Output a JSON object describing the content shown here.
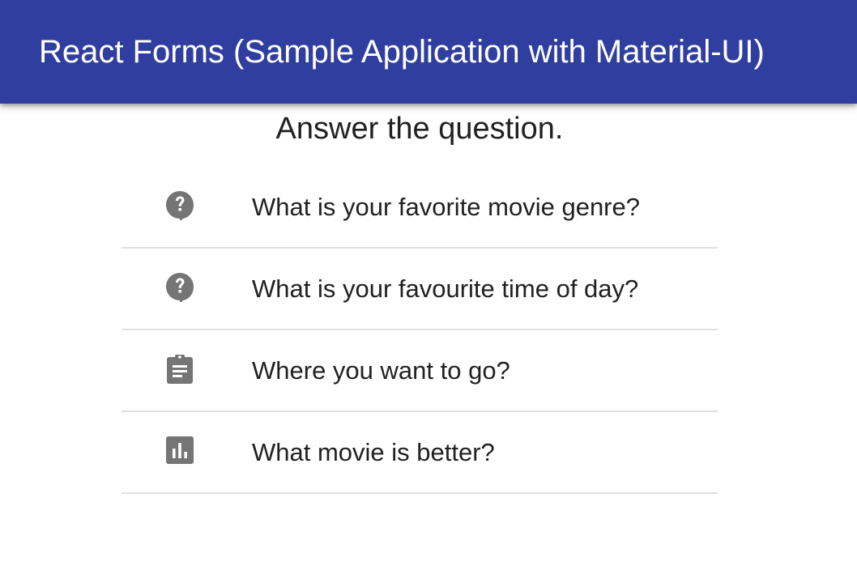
{
  "appbar": {
    "title": "React Forms (Sample Application with Material-UI)",
    "background_color": "#303f9f"
  },
  "main": {
    "heading": "Answer the question.",
    "items": [
      {
        "label": "What is your favorite movie genre?",
        "icon": "question-answer-icon"
      },
      {
        "label": "What is your favourite time of day?",
        "icon": "question-answer-icon"
      },
      {
        "label": "Where you want to go?",
        "icon": "clipboard-icon"
      },
      {
        "label": "What movie is better?",
        "icon": "bar-chart-icon"
      }
    ]
  }
}
